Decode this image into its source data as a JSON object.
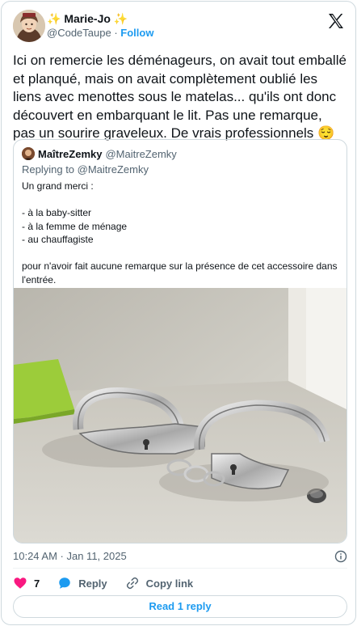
{
  "author": {
    "sparkle_left": "✨",
    "name": "Marie-Jo",
    "sparkle_right": "✨",
    "handle": "@CodeTaupe",
    "separator": "·",
    "follow_label": "Follow"
  },
  "tweet": {
    "text": "Ici on remercie les déménageurs, on avait tout emballé et planqué, mais on avait complètement oublié les liens avec menottes sous le matelas... qu'ils ont donc découvert en embarquant le lit. Pas une remarque, pas un sourire graveleux. De vrais professionnels",
    "emoji": "😌"
  },
  "quote": {
    "name": "MaîtreZemky",
    "handle": "@MaitreZemky",
    "replying_to": "Replying to @MaitreZemky",
    "body": "Un grand merci :\n\n- à la baby-sitter\n- à la femme de ménage\n- au chauffagiste\n\npour n'avoir fait aucune remarque sur la présence de cet accessoire dans l'entrée."
  },
  "meta": {
    "timestamp": "10:24 AM · Jan 11, 2025"
  },
  "actions": {
    "like_count": "7",
    "reply_label": "Reply",
    "copy_link_label": "Copy link"
  },
  "read_replies_label": "Read 1 reply",
  "colors": {
    "accent": "#1d9bf0",
    "like": "#f91880",
    "text": "#0f1419",
    "muted": "#536471",
    "border": "#cfd9de"
  },
  "icons": [
    "x-logo-icon",
    "info-icon",
    "heart-icon",
    "reply-bubble-icon",
    "link-icon"
  ]
}
